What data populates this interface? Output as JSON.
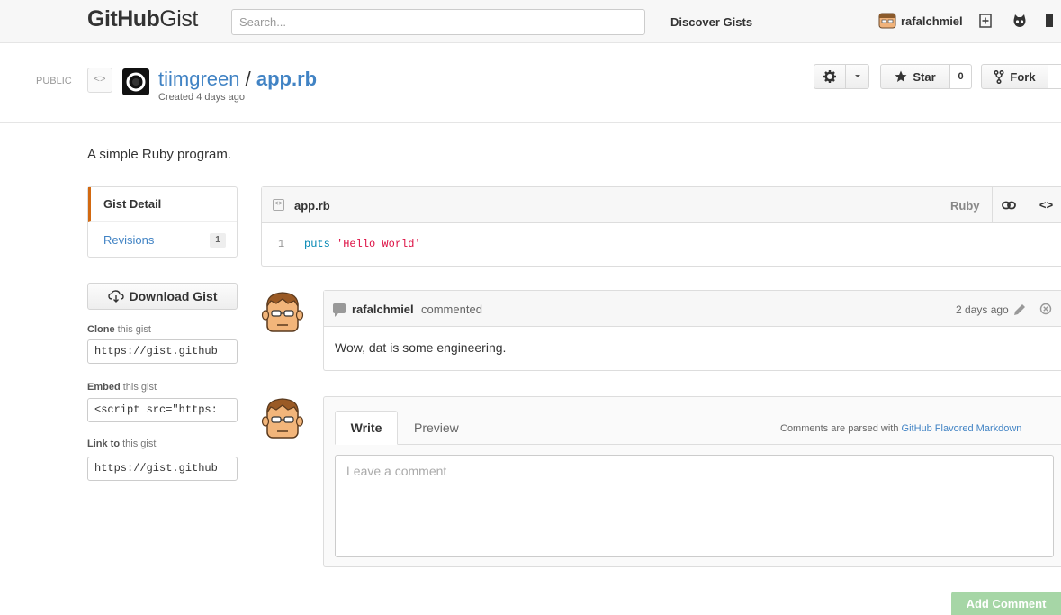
{
  "header": {
    "logo_bold": "GitHub",
    "logo_light": "Gist",
    "search_placeholder": "Search...",
    "discover": "Discover Gists",
    "username": "rafalchmiel"
  },
  "gist": {
    "visibility": "PUBLIC",
    "owner": "tiimgreen",
    "slash": "/",
    "filename": "app.rb",
    "created": "Created 4 days ago",
    "star_label": "Star",
    "star_count": "0",
    "fork_label": "Fork",
    "description": "A simple Ruby program."
  },
  "sidebar": {
    "detail_label": "Gist Detail",
    "revisions_label": "Revisions",
    "revisions_count": "1",
    "download_label": "Download Gist",
    "clone_bold": "Clone",
    "clone_rest": "this gist",
    "clone_url": "https://gist.github",
    "embed_bold": "Embed",
    "embed_rest": "this gist",
    "embed_code": "<script src=\"https:",
    "link_bold": "Link to",
    "link_rest": "this gist",
    "link_url": "https://gist.github"
  },
  "file": {
    "name": "app.rb",
    "language": "Ruby",
    "line_number": "1",
    "code_keyword": "puts",
    "code_string": "'Hello World'"
  },
  "comment": {
    "author": "rafalchmiel",
    "verb": "commented",
    "time": "2 days ago",
    "body": "Wow, dat is some engineering."
  },
  "new_comment": {
    "tab_write": "Write",
    "tab_preview": "Preview",
    "note_prefix": "Comments are parsed with",
    "note_link": "GitHub Flavored Markdown",
    "placeholder": "Leave a comment",
    "submit": "Add Comment"
  },
  "colors": {
    "link": "#4183c4",
    "accent": "#d26911",
    "submit_disabled": "#a6d6a6"
  }
}
